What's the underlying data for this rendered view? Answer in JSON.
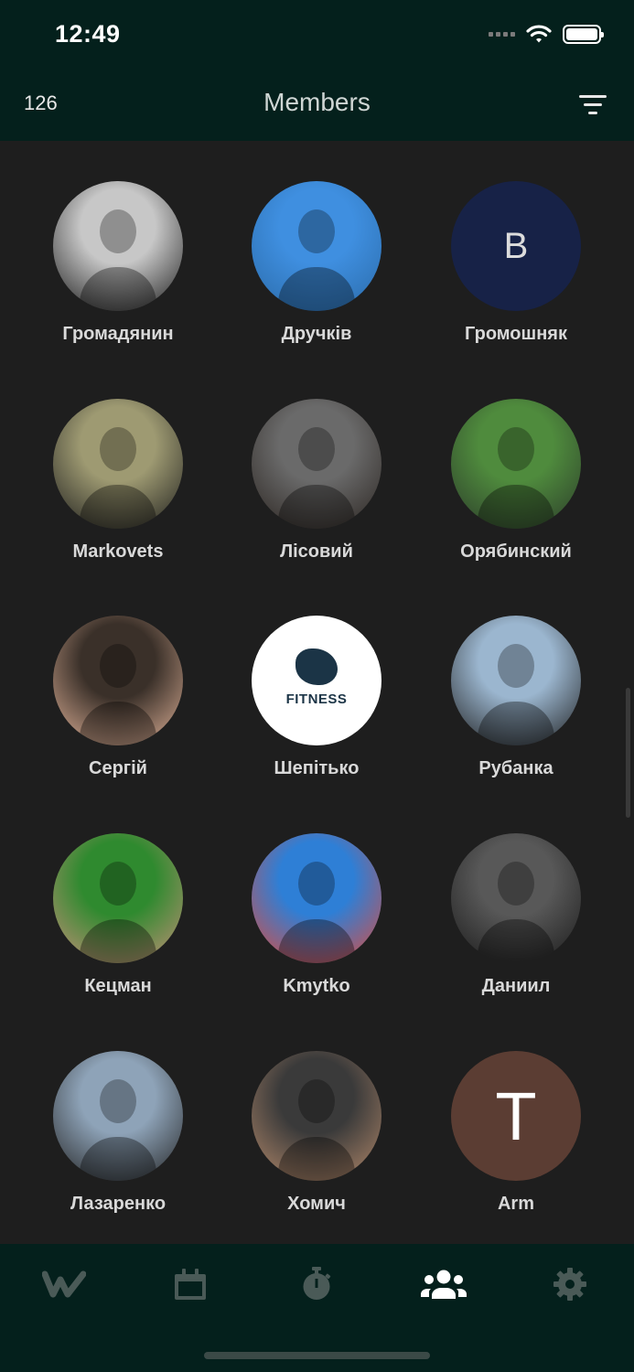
{
  "status_bar": {
    "time": "12:49"
  },
  "header": {
    "member_count": "126",
    "title": "Members"
  },
  "members": [
    {
      "name": "Громадянин",
      "avatar": "photo",
      "colors": [
        "#c7c7c7",
        "#1a1a1a"
      ]
    },
    {
      "name": "Дручків",
      "avatar": "photo",
      "colors": [
        "#3f8fe0",
        "#2a6aa8"
      ]
    },
    {
      "name": "Громошняк",
      "avatar": "letter",
      "letter": "B",
      "colors": [
        "#172247"
      ]
    },
    {
      "name": "Markovets",
      "avatar": "photo",
      "colors": [
        "#9e9a72",
        "#1c1c1c"
      ]
    },
    {
      "name": "Лісовий",
      "avatar": "photo",
      "colors": [
        "#6a6a6a",
        "#2a2420"
      ]
    },
    {
      "name": "Орябинский",
      "avatar": "photo",
      "colors": [
        "#4f8b3d",
        "#2b3a2a"
      ]
    },
    {
      "name": "Сергій",
      "avatar": "photo",
      "colors": [
        "#3a3029",
        "#e2b49a"
      ]
    },
    {
      "name": "Шепітько",
      "avatar": "logo",
      "logo_text": "FITNESS",
      "colors": [
        "#ffffff"
      ]
    },
    {
      "name": "Рубанка",
      "avatar": "photo",
      "colors": [
        "#9bb6cf",
        "#1d1d1d"
      ]
    },
    {
      "name": "Кецман",
      "avatar": "photo",
      "colors": [
        "#2f8a2f",
        "#c98f7a"
      ]
    },
    {
      "name": "Kmytko",
      "avatar": "photo",
      "colors": [
        "#2e7fd6",
        "#e04a3a"
      ]
    },
    {
      "name": "Даниил",
      "avatar": "photo",
      "colors": [
        "#585858",
        "#1a1a1a"
      ]
    },
    {
      "name": "Лазаренко",
      "avatar": "photo",
      "colors": [
        "#8ea3b8",
        "#222222"
      ]
    },
    {
      "name": "Хомич",
      "avatar": "photo",
      "colors": [
        "#3a3a3a",
        "#b58a6b"
      ]
    },
    {
      "name": "Arm",
      "avatar": "letter",
      "letter": "T",
      "colors": [
        "#5b3d33"
      ]
    }
  ],
  "tabs": [
    {
      "name": "workouts",
      "icon": "w-logo-icon",
      "active": false
    },
    {
      "name": "calendar",
      "icon": "calendar-icon",
      "active": false
    },
    {
      "name": "timer",
      "icon": "stopwatch-icon",
      "active": false
    },
    {
      "name": "members",
      "icon": "users-icon",
      "active": true
    },
    {
      "name": "settings",
      "icon": "gear-icon",
      "active": false
    }
  ],
  "theme": {
    "bar_bg": "#04201c",
    "content_bg": "#1e1e1e",
    "tab_inactive": "#4a5a57",
    "tab_active": "#ffffff"
  }
}
